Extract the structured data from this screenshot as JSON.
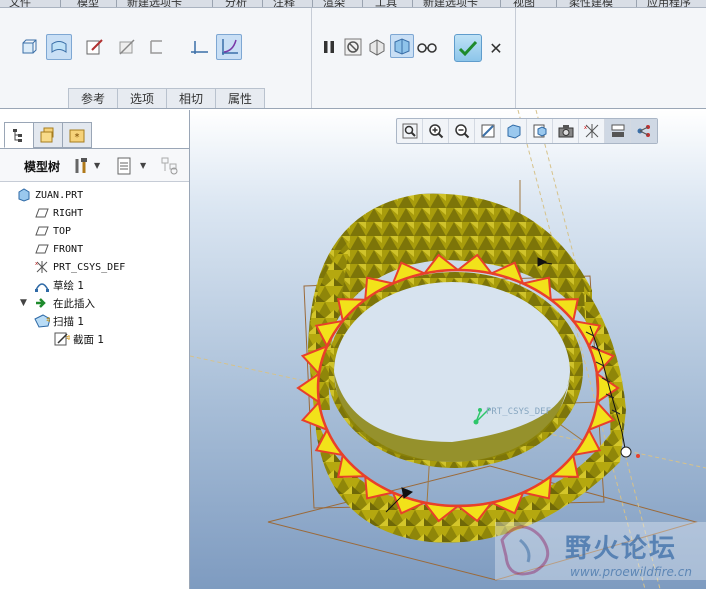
{
  "menubar": {
    "items": [
      "文件",
      "模型",
      "新建选项卡",
      "分析",
      "注释",
      "渲染",
      "工具",
      "新建选项卡",
      "视图",
      "柔性建模",
      "应用程序"
    ]
  },
  "ribbon": {
    "subtabs": [
      "参考",
      "选项",
      "相切",
      "属性"
    ],
    "left_icons": [
      "solid-icon",
      "surface-icon",
      "sketch-icon",
      "remove-material-icon",
      "thicken-icon",
      "constant-section-icon",
      "variable-section-icon"
    ],
    "right_icons": [
      "pause-icon",
      "no-preview-icon",
      "preview-geometry-icon",
      "verify-icon",
      "glasses-icon"
    ],
    "ok_label": "✔",
    "cancel_label": "✕"
  },
  "left_panel": {
    "tabs": [
      "model-tree-tab",
      "folder-browser-tab",
      "favorites-tab"
    ],
    "tree_title": "模型树",
    "tree": [
      {
        "label": "ZUAN.PRT",
        "icon": "part-icon",
        "indent": 0
      },
      {
        "label": "RIGHT",
        "icon": "datum-plane-icon",
        "indent": 1
      },
      {
        "label": "TOP",
        "icon": "datum-plane-icon",
        "indent": 1
      },
      {
        "label": "FRONT",
        "icon": "datum-plane-icon",
        "indent": 1
      },
      {
        "label": "PRT_CSYS_DEF",
        "icon": "csys-icon",
        "indent": 1
      },
      {
        "label": "草绘 1",
        "icon": "sketch-curve-icon",
        "indent": 1
      },
      {
        "label": "在此插入",
        "icon": "insert-here-arrow-icon",
        "indent": 1
      },
      {
        "label": "扫描 1",
        "icon": "sweep-feature-icon",
        "indent": 1,
        "expanded": true
      },
      {
        "label": "截面 1",
        "icon": "section-sketch-icon",
        "indent": 2
      }
    ]
  },
  "viewport": {
    "toolbar_icons": [
      "refit-icon",
      "zoom-in-icon",
      "zoom-out-icon",
      "repaint-icon",
      "display-style-icon",
      "saved-views-icon",
      "view-manager-icon",
      "datum-display-icon",
      "annotation-display-icon",
      "spin-center-icon"
    ],
    "datum_label": "PRT_CSYS_DEF",
    "watermark": "野火论坛",
    "watermark_url": "www.proewildfire.cn",
    "colors": {
      "part_fill": "#b5a80f",
      "part_dark": "#6f6808",
      "section_edge": "#e8402a",
      "section_fill": "#f2e21a",
      "datum_plane": "#9b6a3a"
    }
  }
}
